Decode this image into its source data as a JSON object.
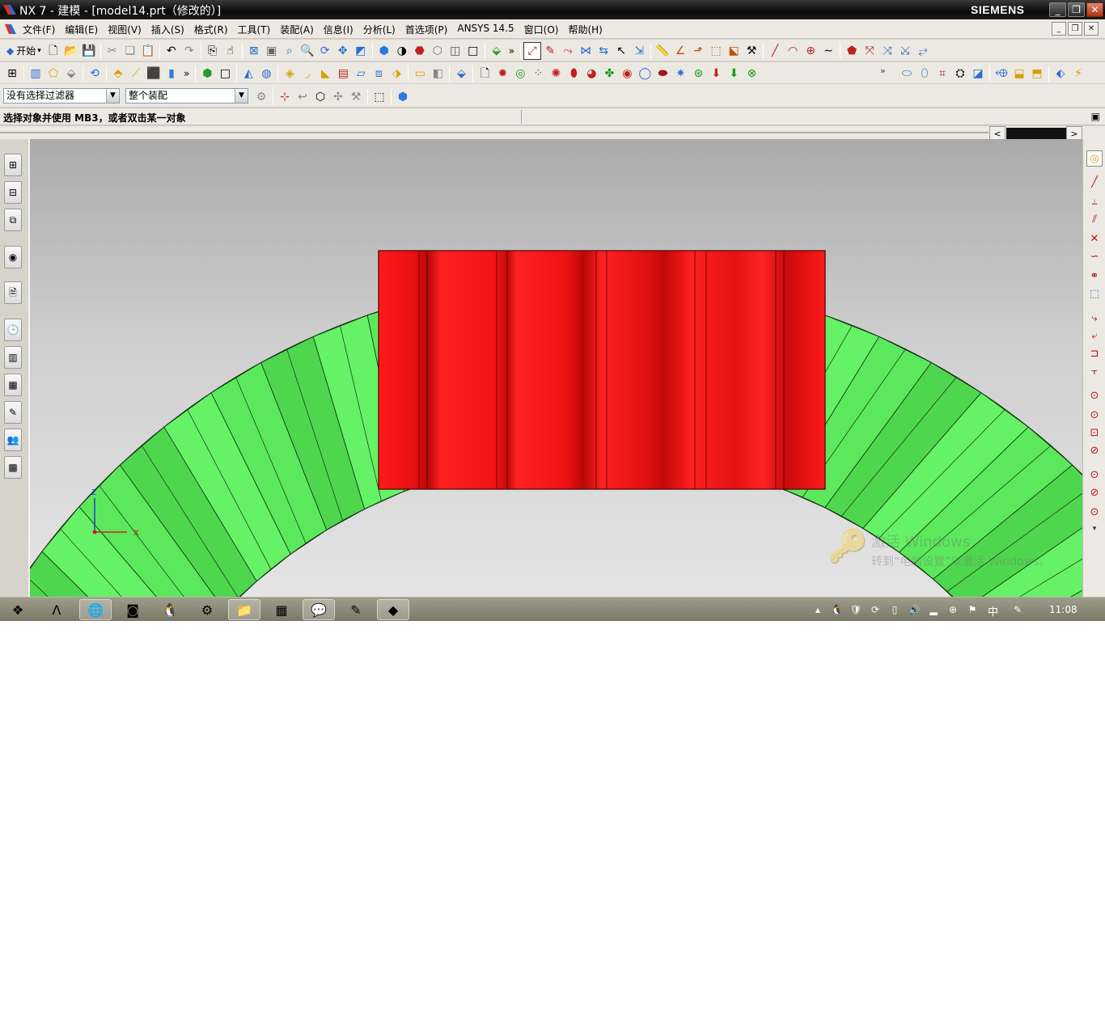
{
  "window": {
    "title": "NX 7 - 建模 - [model14.prt（修改的）]",
    "brand": "SIEMENS",
    "buttons": {
      "minimize": "_",
      "restore": "❐",
      "close": "✕"
    }
  },
  "menubar": {
    "items": [
      "文件(F)",
      "编辑(E)",
      "视图(V)",
      "插入(S)",
      "格式(R)",
      "工具(T)",
      "装配(A)",
      "信息(I)",
      "分析(L)",
      "首选项(P)",
      "ANSYS 14.5",
      "窗口(O)",
      "帮助(H)"
    ],
    "mdi": {
      "minimize": "_",
      "restore": "❐",
      "close": "✕"
    }
  },
  "toolbar1": {
    "start_label": "开始",
    "start_arrow": "▾",
    "chevron": "»"
  },
  "selectbar": {
    "filter": {
      "value": "没有选择过滤器",
      "arrow": "▼"
    },
    "scope": {
      "value": "整个装配",
      "arrow": "▼"
    }
  },
  "status": {
    "prompt": "选择对象并使用 MB3，或者双击某一对象",
    "scroll_left": "<",
    "scroll_right": ">"
  },
  "viewport": {
    "triad": {
      "z_label": "Z",
      "x_label": "X"
    },
    "watermark": {
      "title": "激活 Windows",
      "subtitle": "转到“电脑设置”以激活 Windows。"
    },
    "colors": {
      "gear": "#66f266",
      "block": "#ff1a1a"
    }
  },
  "taskbar": {
    "clock": "11:08",
    "ime": "中"
  },
  "icons": {
    "toolbar1": [
      "new-file-icon",
      "open-folder-icon",
      "save-icon",
      "cut-icon",
      "copy-icon",
      "paste-icon",
      "undo-icon",
      "redo-icon",
      "repeat-command-icon",
      "touch-mode-icon",
      "fit-view-icon",
      "zoom-window-icon",
      "zoom-icon",
      "rotate-icon",
      "pan-icon",
      "perspective-icon",
      "shaded-view-icon",
      "render-icon",
      "wireframe-icon",
      "hidden-edges-icon",
      "layer-icon",
      "display-icon",
      "snap-point-icon",
      "sketch-icon",
      "curve-icon",
      "line-icon",
      "arc-icon",
      "spline-icon",
      "analysis-icon"
    ],
    "toolbar2": [
      "assembly-navigator-icon",
      "part-icon",
      "feature-icon",
      "extrude-icon",
      "revolve-icon",
      "hole-icon",
      "boss-icon",
      "block-icon",
      "cylinder-icon",
      "cone-icon",
      "sphere-icon",
      "boolean-icon",
      "edge-blend-icon",
      "chamfer-icon",
      "shell-icon",
      "draft-icon",
      "trim-icon",
      "split-icon",
      "pattern-icon",
      "mirror-icon",
      "color-icon"
    ],
    "rightbar": [
      "quick-pick-icon",
      "line-tool-icon",
      "arc-tool-icon",
      "point-tool-icon",
      "curve-tool-icon",
      "offset-icon",
      "link-icon",
      "trim-curve-icon",
      "extend-icon",
      "fillet-curve-icon",
      "constraint-icon",
      "dimension-icon",
      "circle-icon",
      "ellipse-icon",
      "polygon-icon"
    ]
  }
}
